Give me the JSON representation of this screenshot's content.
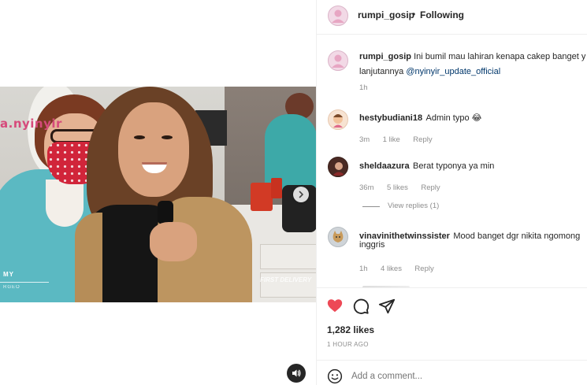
{
  "media": {
    "overlay_handle": "a.nyinyir",
    "lower_third_line1": "MY",
    "lower_third_line2": "RGEO",
    "watermark": "FIRST DELIVERY"
  },
  "header": {
    "username": "rumpi_gosip",
    "separator": "•",
    "follow_status": "Following"
  },
  "caption": {
    "username": "rumpi_gosip",
    "text_line1": "Ini bumil mau lahiran kenapa cakep banget y",
    "text_line2_prefix": "lanjutannya ",
    "mention": "@nyinyir_update_official",
    "time": "1h"
  },
  "comments": [
    {
      "username": "hestybudiani18",
      "text": "Admin typo 😂",
      "time": "3m",
      "likes": "1 like",
      "reply": "Reply"
    },
    {
      "username": "sheldaazura",
      "text": "Berat typonya ya min",
      "time": "36m",
      "likes": "5 likes",
      "reply": "Reply",
      "view_replies": "View replies (1)"
    },
    {
      "username": "vinavinithetwinssister",
      "text_line1": "Mood banget dgr nikita ngomong",
      "text_line2": "inggris",
      "time": "1h",
      "likes": "4 likes",
      "reply": "Reply"
    }
  ],
  "actions": {
    "likes": "1,282 likes",
    "timestamp": "1 HOUR AGO",
    "like_color": "#ed4956"
  },
  "add_comment": {
    "placeholder": "Add a comment..."
  }
}
